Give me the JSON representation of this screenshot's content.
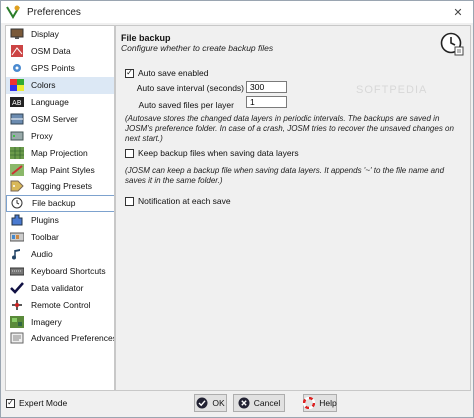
{
  "window": {
    "title": "Preferences"
  },
  "sidebar": {
    "items": [
      {
        "label": "Display",
        "icon": "display-icon"
      },
      {
        "label": "OSM Data",
        "icon": "osm-data-icon"
      },
      {
        "label": "GPS Points",
        "icon": "gps-points-icon"
      },
      {
        "label": "Colors",
        "icon": "colors-icon"
      },
      {
        "label": "Language",
        "icon": "language-icon"
      },
      {
        "label": "OSM Server",
        "icon": "osm-server-icon"
      },
      {
        "label": "Proxy",
        "icon": "proxy-icon"
      },
      {
        "label": "Map Projection",
        "icon": "map-projection-icon"
      },
      {
        "label": "Map Paint Styles",
        "icon": "map-paint-styles-icon"
      },
      {
        "label": "Tagging Presets",
        "icon": "tagging-presets-icon"
      },
      {
        "label": "File backup",
        "icon": "file-backup-icon",
        "active": true
      },
      {
        "label": "Plugins",
        "icon": "plugins-icon"
      },
      {
        "label": "Toolbar",
        "icon": "toolbar-icon"
      },
      {
        "label": "Audio",
        "icon": "audio-icon"
      },
      {
        "label": "Keyboard Shortcuts",
        "icon": "keyboard-shortcuts-icon"
      },
      {
        "label": "Data validator",
        "icon": "data-validator-icon"
      },
      {
        "label": "Remote Control",
        "icon": "remote-control-icon"
      },
      {
        "label": "Imagery",
        "icon": "imagery-icon"
      },
      {
        "label": "Advanced Preferences",
        "icon": "advanced-preferences-icon"
      }
    ]
  },
  "panel": {
    "title": "File backup",
    "subtitle": "Configure whether to create backup files",
    "auto_save": {
      "label": "Auto save enabled",
      "checked": true
    },
    "interval": {
      "label": "Auto save interval (seconds)",
      "value": "300"
    },
    "files_per_layer": {
      "label": "Auto saved files per layer",
      "value": "1"
    },
    "autosave_note": "(Autosave stores the changed data layers in periodic intervals. The backups are saved in JOSM's preference folder. In case of a crash, JOSM tries to recover the unsaved changes on next start.)",
    "keep_backup": {
      "label": "Keep backup files when saving data layers",
      "checked": false
    },
    "backup_note": "(JOSM can keep a backup file when saving data layers. It appends '~' to the file name and saves it in the same folder.)",
    "notification": {
      "label": "Notification at each save",
      "checked": false
    }
  },
  "watermark": "SOFTPEDIA",
  "footer": {
    "expert_mode": {
      "label": "Expert Mode",
      "checked": true
    },
    "ok_label": "OK",
    "cancel_label": "Cancel",
    "help_label": "Help"
  }
}
